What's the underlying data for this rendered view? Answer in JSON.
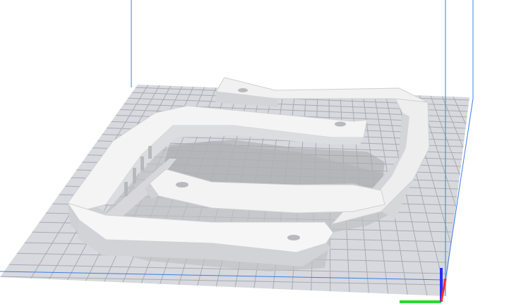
{
  "viewport": {
    "background": "#ffffff",
    "icons": [
      "build-plate-icon",
      "axis-gizmo-icon"
    ]
  },
  "colors": {
    "plate": "#d7d9de",
    "grid": "#a9abb3",
    "build_volume": "#3c7fe0",
    "model_top": "#f5f5f5",
    "model_side": "#cfd0d3",
    "model_shadow": "#d9dadc",
    "axis_x": "#ff2a2a",
    "axis_y": "#2bd92b",
    "axis_z": "#2b2bff"
  }
}
